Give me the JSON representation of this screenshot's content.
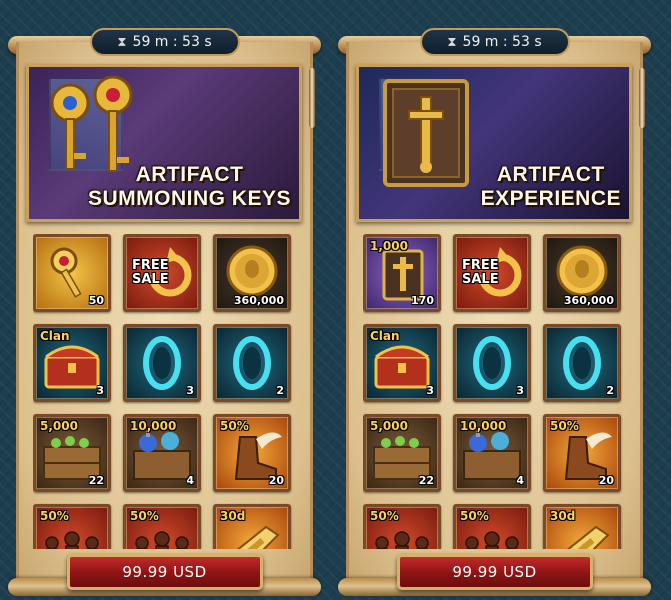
{
  "panels": [
    {
      "timer": "59 m : 53 s",
      "title_line1": "ARTIFACT",
      "title_line2": "SUMMONING KEYS",
      "banner_icon": "key-icon",
      "price": "99.99 USD",
      "items": [
        {
          "icon": "summoning-key-icon",
          "count": "50",
          "tag": ""
        },
        {
          "icon": "free-sale-icon",
          "count": "",
          "tag": "FREE SALE"
        },
        {
          "icon": "gold-coin-icon",
          "count": "360,000",
          "tag": ""
        },
        {
          "icon": "clan-chest-icon",
          "count": "3",
          "tag": "Clan"
        },
        {
          "icon": "portal-icon",
          "count": "3",
          "tag": ""
        },
        {
          "icon": "portal-icon",
          "count": "2",
          "tag": ""
        },
        {
          "icon": "supplies-crate-icon",
          "count": "22",
          "tag": "5,000"
        },
        {
          "icon": "potion-crate-icon",
          "count": "4",
          "tag": "10,000"
        },
        {
          "icon": "winged-boot-icon",
          "count": "20",
          "tag": "50%"
        },
        {
          "icon": "army-icon",
          "count": "",
          "tag": "50%"
        },
        {
          "icon": "army-icon",
          "count": "",
          "tag": "50%"
        },
        {
          "icon": "horn-icon",
          "count": "",
          "tag": "30d"
        }
      ]
    },
    {
      "timer": "59 m : 53 s",
      "title_line1": "ARTIFACT",
      "title_line2": "EXPERIENCE",
      "banner_icon": "book-icon",
      "price": "99.99 USD",
      "items": [
        {
          "icon": "artifact-xp-book-icon",
          "count": "170",
          "tag": "1,000"
        },
        {
          "icon": "free-sale-icon",
          "count": "",
          "tag": "FREE SALE"
        },
        {
          "icon": "gold-coin-icon",
          "count": "360,000",
          "tag": ""
        },
        {
          "icon": "clan-chest-icon",
          "count": "3",
          "tag": "Clan"
        },
        {
          "icon": "portal-icon",
          "count": "3",
          "tag": ""
        },
        {
          "icon": "portal-icon",
          "count": "2",
          "tag": ""
        },
        {
          "icon": "supplies-crate-icon",
          "count": "22",
          "tag": "5,000"
        },
        {
          "icon": "potion-crate-icon",
          "count": "4",
          "tag": "10,000"
        },
        {
          "icon": "winged-boot-icon",
          "count": "20",
          "tag": "50%"
        },
        {
          "icon": "army-icon",
          "count": "",
          "tag": "50%"
        },
        {
          "icon": "army-icon",
          "count": "",
          "tag": "50%"
        },
        {
          "icon": "horn-icon",
          "count": "",
          "tag": "30d"
        }
      ]
    }
  ],
  "colors": {
    "background": "#1d3e4e",
    "parchment": "#e6cf9f",
    "price_button": "#b01f1f",
    "gold_trim": "#c9a05a"
  }
}
